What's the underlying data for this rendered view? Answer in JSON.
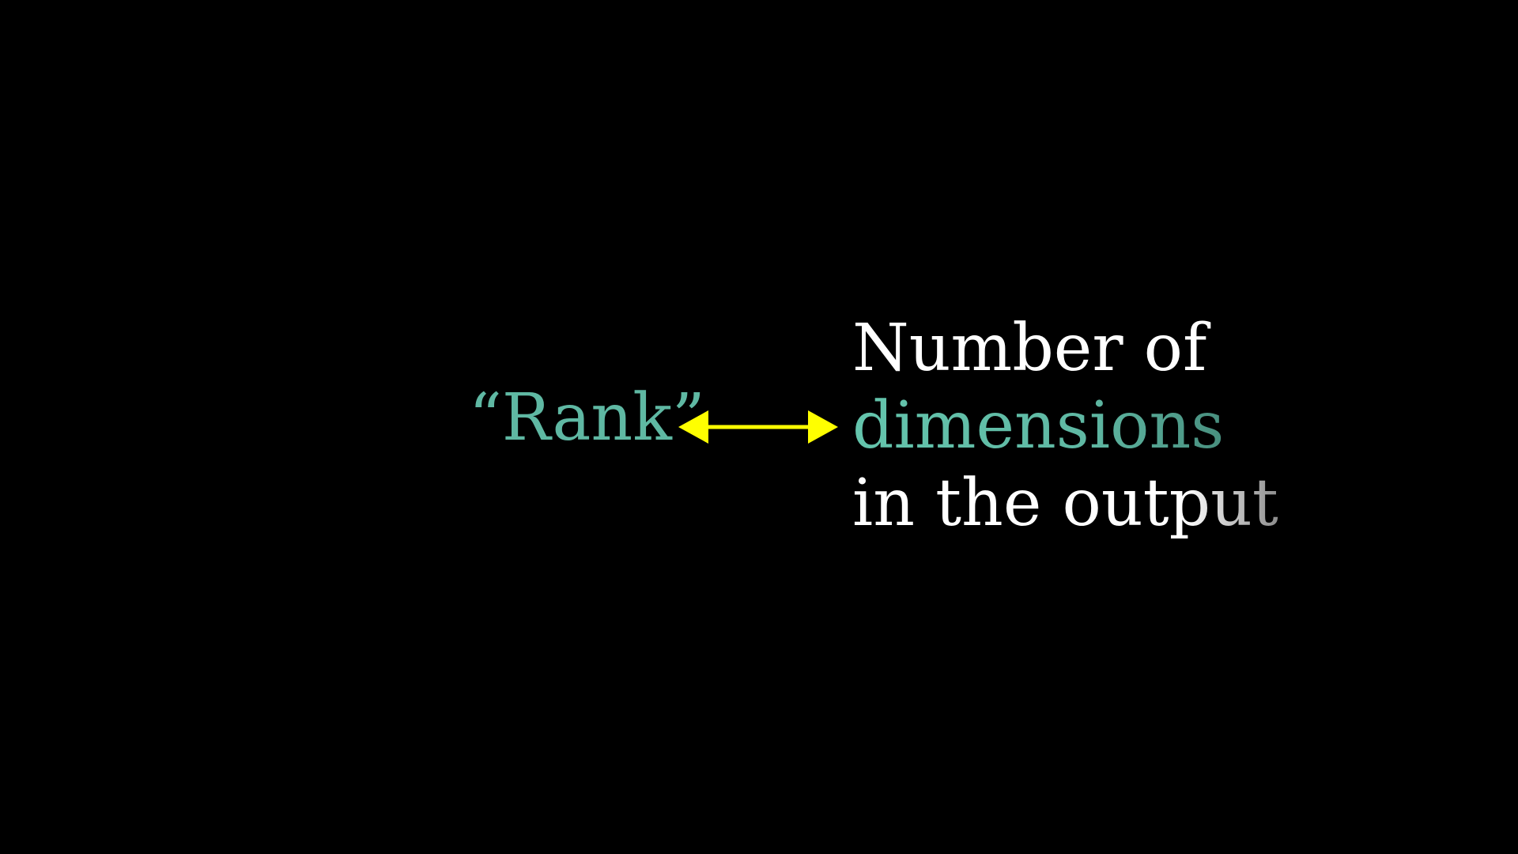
{
  "term": {
    "label": "“Rank”",
    "color": "#5fb8a3"
  },
  "connector": {
    "icon": "double-headed-arrow-icon",
    "color": "#ffff00"
  },
  "definition": {
    "line1": "Number of",
    "line2": "dimensions",
    "line3": "in the output",
    "highlight_color": "#5fb8a3",
    "text_color": "#ffffff"
  },
  "background_color": "#000000"
}
